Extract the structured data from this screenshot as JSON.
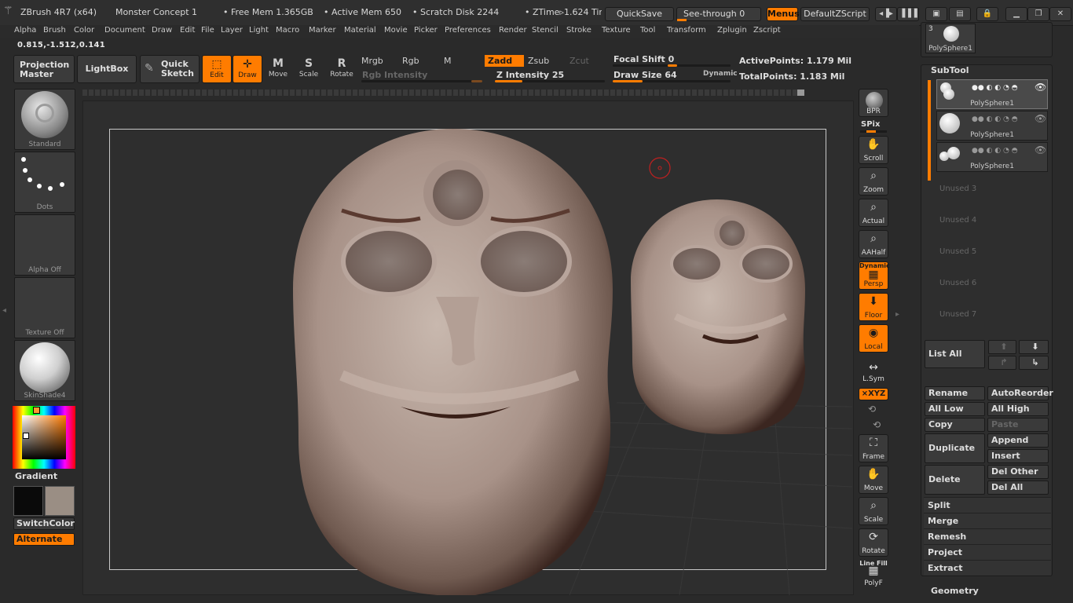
{
  "titlebar": {
    "app": "ZBrush 4R7 (x64)",
    "document": "Monster Concept 1",
    "free_mem": "• Free Mem 1.365GB",
    "active_mem": "• Active Mem 650",
    "scratch_disk": "• Scratch Disk 2244",
    "ztime": "• ZTime▹1.624 Tir",
    "quicksave": "QuickSave",
    "see_through": "See-through  0",
    "menus": "Menus",
    "script": "DefaultZScript"
  },
  "menu": [
    "Alpha",
    "Brush",
    "Color",
    "Document",
    "Draw",
    "Edit",
    "File",
    "Layer",
    "Light",
    "Macro",
    "Marker",
    "Material",
    "Movie",
    "Picker",
    "Preferences",
    "Render",
    "Stencil",
    "Stroke",
    "Texture",
    "Tool",
    "Transform",
    "Zplugin",
    "Zscript"
  ],
  "coords": "0.815,-1.512,0.141",
  "shelf": {
    "projection_master": "Projection Master",
    "lightbox": "LightBox",
    "quick_sketch": "Quick Sketch",
    "edit": "Edit",
    "draw": "Draw",
    "move": "Move",
    "scale": "Scale",
    "rotate": "Rotate",
    "mrgb": "Mrgb",
    "rgb": "Rgb",
    "m": "M",
    "zadd": "Zadd",
    "zsub": "Zsub",
    "zcut": "Zcut",
    "rgb_intensity": "Rgb  Intensity",
    "z_intensity": "Z Intensity 25",
    "z_intensity_value": 25,
    "focal_shift": "Focal  Shift 0",
    "draw_size": "Draw  Size 64",
    "draw_size_value": 64,
    "dynamic": "Dynamic",
    "active_points": "ActivePoints: 1.179  Mil",
    "total_points": "TotalPoints: 1.183  Mil"
  },
  "left": {
    "brush": "Standard",
    "stroke": "Dots",
    "alpha": "Alpha  Off",
    "texture": "Texture  Off",
    "material": "SkinShade4",
    "gradient": "Gradient",
    "switchcolor": "SwitchColor",
    "alternate": "Alternate",
    "primary_color": "#0a0a0a",
    "secondary_color": "#9a8e84"
  },
  "right_tools": {
    "bpr": "BPR",
    "spix": "SPix",
    "scroll": "Scroll",
    "zoom": "Zoom",
    "actual": "Actual",
    "aahalf": "AAHalf",
    "dynamic": "Dynamic",
    "persp": "Persp",
    "floor": "Floor",
    "local": "Local",
    "lsym": "L.Sym",
    "xyz": "⨯XYZ",
    "frame": "Frame",
    "move": "Move",
    "scale": "Scale",
    "rotate": "Rotate",
    "linefill": "Line Fill",
    "polyf": "PolyF"
  },
  "subtool": {
    "header": "SubTool",
    "top_thumb_count": "3",
    "top_thumb_name": "PolySphere1",
    "items": [
      {
        "name": "PolySphere1"
      },
      {
        "name": "PolySphere1"
      },
      {
        "name": "PolySphere1"
      }
    ],
    "unused": [
      "Unused  3",
      "Unused  4",
      "Unused  5",
      "Unused  6",
      "Unused  7"
    ],
    "list_all": "List  All",
    "rename": "Rename",
    "autoreorder": "AutoReorder",
    "all_low": "All Low",
    "all_high": "All High",
    "copy": "Copy",
    "paste": "Paste",
    "duplicate": "Duplicate",
    "append": "Append",
    "insert": "Insert",
    "delete": "Delete",
    "del_other": "Del Other",
    "del_all": "Del All",
    "split": "Split",
    "merge": "Merge",
    "remesh": "Remesh",
    "project": "Project",
    "extract": "Extract",
    "geometry": "Geometry"
  }
}
